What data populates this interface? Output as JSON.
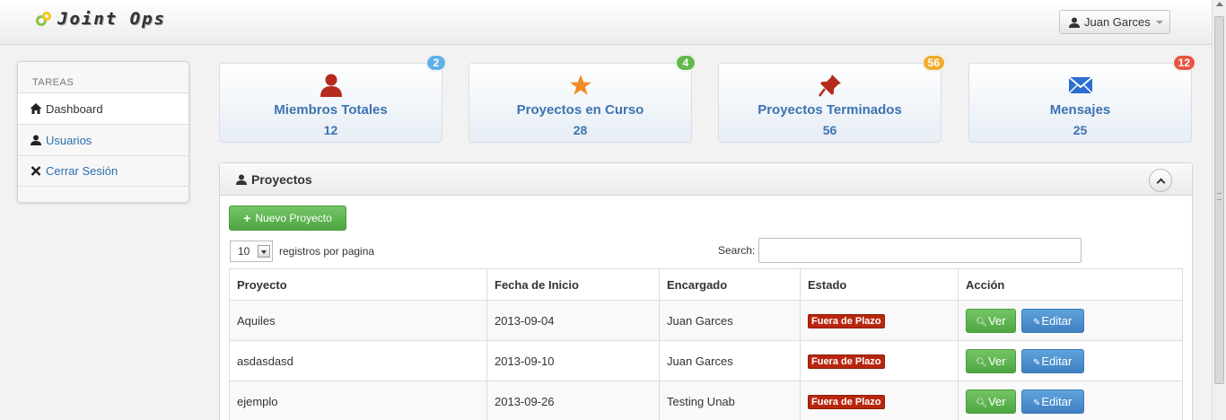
{
  "navbar": {
    "brand": "Joint Ops",
    "user_name": "Juan Garces"
  },
  "sidebar": {
    "header": "TAREAS",
    "items": [
      {
        "label": "Dashboard",
        "icon": "home-icon"
      },
      {
        "label": "Usuarios",
        "icon": "user-icon"
      },
      {
        "label": "Cerrar Sesión",
        "icon": "close-icon"
      }
    ]
  },
  "stats": [
    {
      "title": "Miembros Totales",
      "value": "12",
      "badge": "2",
      "badge_color": "#5fb0e8",
      "icon": "user-icon",
      "icon_color": "#b52a1c"
    },
    {
      "title": "Proyectos en Curso",
      "value": "28",
      "badge": "4",
      "badge_color": "#62b84c",
      "icon": "star-icon",
      "icon_color": "#f08a24"
    },
    {
      "title": "Proyectos Terminados",
      "value": "56",
      "badge": "56",
      "badge_color": "#f0ad2e",
      "icon": "pushpin-icon",
      "icon_color": "#b52a1c"
    },
    {
      "title": "Mensajes",
      "value": "25",
      "badge": "12",
      "badge_color": "#e8553f",
      "icon": "envelope-icon",
      "icon_color": "#2a6fcf"
    }
  ],
  "panel": {
    "title": "Proyectos",
    "new_button": "Nuevo Proyecto",
    "page_length": "10",
    "page_length_label": "registros por pagina",
    "search_label": "Search:",
    "search_value": ""
  },
  "table": {
    "headers": [
      "Proyecto",
      "Fecha de Inicio",
      "Encargado",
      "Estado",
      "Acción"
    ],
    "rows": [
      {
        "proyecto": "Aquiles",
        "fecha": "2013-09-04",
        "encargado": "Juan Garces",
        "estado": "Fuera de Plazo"
      },
      {
        "proyecto": "asdasdasd",
        "fecha": "2013-09-10",
        "encargado": "Juan Garces",
        "estado": "Fuera de Plazo"
      },
      {
        "proyecto": "ejemplo",
        "fecha": "2013-09-26",
        "encargado": "Testing Unab",
        "estado": "Fuera de Plazo"
      }
    ],
    "ver_label": "Ver",
    "editar_label": "Editar"
  }
}
